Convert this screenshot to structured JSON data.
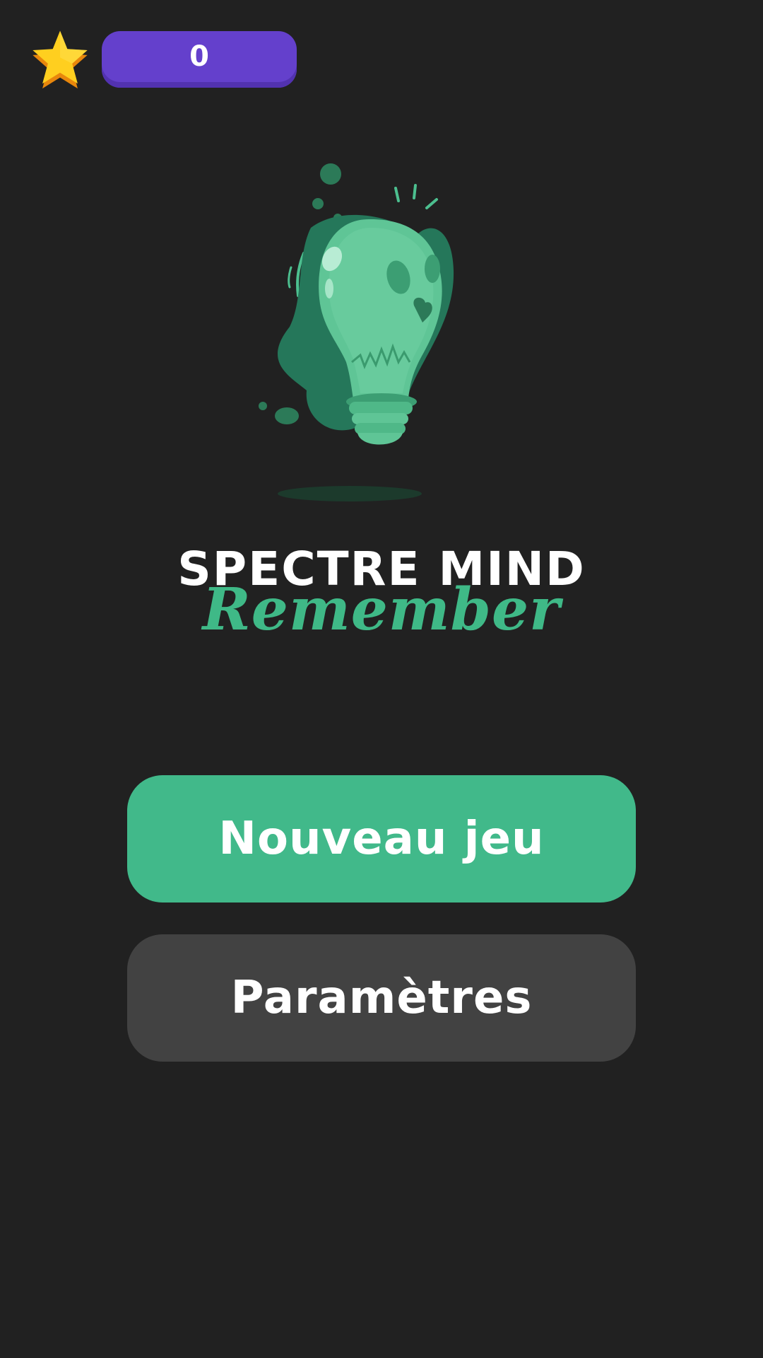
{
  "header": {
    "star_icon": "star-icon",
    "score": "0"
  },
  "illustration": {
    "icon": "lightbulb-icon"
  },
  "logo": {
    "title": "SPECTRE MIND",
    "subtitle": "Remember"
  },
  "menu": {
    "new_game_label": "Nouveau jeu",
    "settings_label": "Paramètres"
  },
  "colors": {
    "background": "#212121",
    "accent_green": "#41b98a",
    "score_purple": "#6440cc",
    "secondary_button": "#424242",
    "star_yellow": "#ffd21f",
    "star_orange": "#f29a16"
  }
}
